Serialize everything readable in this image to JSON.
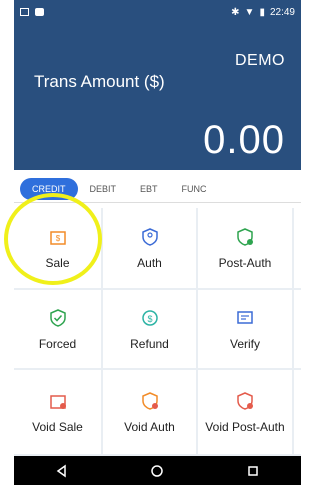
{
  "status_bar": {
    "time": "22:49",
    "bluetooth_icon": "bluetooth-icon",
    "wifi_icon": "wifi-icon",
    "battery_icon": "battery-icon"
  },
  "header": {
    "mode": "DEMO",
    "amount_label": "Trans Amount ($)",
    "amount_value": "0.00"
  },
  "tabs": [
    {
      "label": "CREDIT"
    },
    {
      "label": "DEBIT"
    },
    {
      "label": "EBT"
    },
    {
      "label": "FUNC"
    }
  ],
  "actions": [
    {
      "label": "Sale",
      "icon": "sale-icon",
      "color": "#f28c28"
    },
    {
      "label": "Auth",
      "icon": "auth-icon",
      "color": "#3b6bd6"
    },
    {
      "label": "Post-Auth",
      "icon": "post-auth-icon",
      "color": "#2ea44f"
    },
    {
      "label": "Forced",
      "icon": "forced-icon",
      "color": "#2ea44f"
    },
    {
      "label": "Refund",
      "icon": "refund-icon",
      "color": "#2bb3a4"
    },
    {
      "label": "Verify",
      "icon": "verify-icon",
      "color": "#3b6bd6"
    },
    {
      "label": "Void Sale",
      "icon": "void-sale-icon",
      "color": "#e45b4b"
    },
    {
      "label": "Void Auth",
      "icon": "void-auth-icon",
      "color": "#f28c28"
    },
    {
      "label": "Void Post-Auth",
      "icon": "void-post-auth-icon",
      "color": "#e45b4b"
    }
  ],
  "navbar": {
    "back_icon": "back-icon",
    "home_icon": "home-icon",
    "recent_icon": "recent-apps-icon"
  },
  "colors": {
    "header_bg": "#294f7e",
    "active_tab": "#2f6fdc",
    "highlight": "#f0f01a"
  }
}
